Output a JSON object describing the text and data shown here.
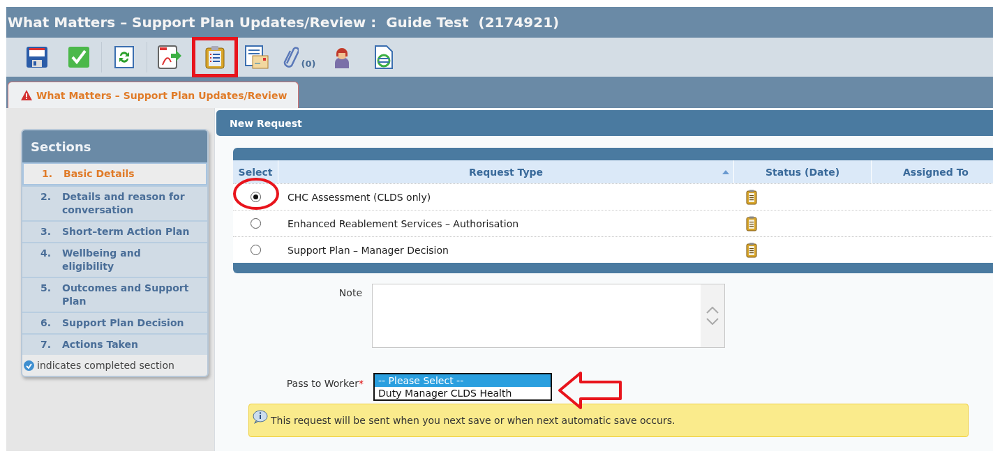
{
  "window": {
    "title": "What Matters – Support Plan Updates/Review :  Guide Test  (2174921)"
  },
  "toolbar": {
    "attachment_count": "(0)"
  },
  "tabs": [
    {
      "label": "What Matters – Support Plan Updates/Review",
      "selected": true,
      "warning": true
    }
  ],
  "sections": {
    "title": "Sections",
    "items": [
      {
        "number": "1.",
        "label": "Basic Details",
        "selected": true
      },
      {
        "number": "2.",
        "label": "Details and reason for conversation",
        "selected": false
      },
      {
        "number": "3.",
        "label": "Short–term Action Plan",
        "selected": false
      },
      {
        "number": "4.",
        "label": "Wellbeing and eligibility",
        "selected": false
      },
      {
        "number": "5.",
        "label": "Outcomes and Support Plan",
        "selected": false
      },
      {
        "number": "6.",
        "label": "Support Plan Decision",
        "selected": false
      },
      {
        "number": "7.",
        "label": "Actions Taken",
        "selected": false
      }
    ],
    "legend": "indicates completed section"
  },
  "panel": {
    "title": "New Request",
    "table": {
      "columns": [
        {
          "label": "Select",
          "sorted": false
        },
        {
          "label": "Request Type",
          "sorted": true
        },
        {
          "label": "Status (Date)",
          "sorted": false
        },
        {
          "label": "Assigned To",
          "sorted": false
        }
      ],
      "rows": [
        {
          "request_type": "CHC Assessment (CLDS only)",
          "selected": true
        },
        {
          "request_type": "Enhanced Reablement Services – Authorisation",
          "selected": false
        },
        {
          "request_type": "Support Plan – Manager Decision",
          "selected": false
        }
      ]
    },
    "note": {
      "label": "Note"
    },
    "pass_to_worker": {
      "label": "Pass to Worker",
      "required_mark": "*",
      "options": [
        {
          "label": "-- Please Select --",
          "selected": true
        },
        {
          "label": "Duty Manager CLDS Health",
          "selected": false
        }
      ]
    },
    "info": "This request will be sent when you next save or when next automatic save occurs."
  }
}
